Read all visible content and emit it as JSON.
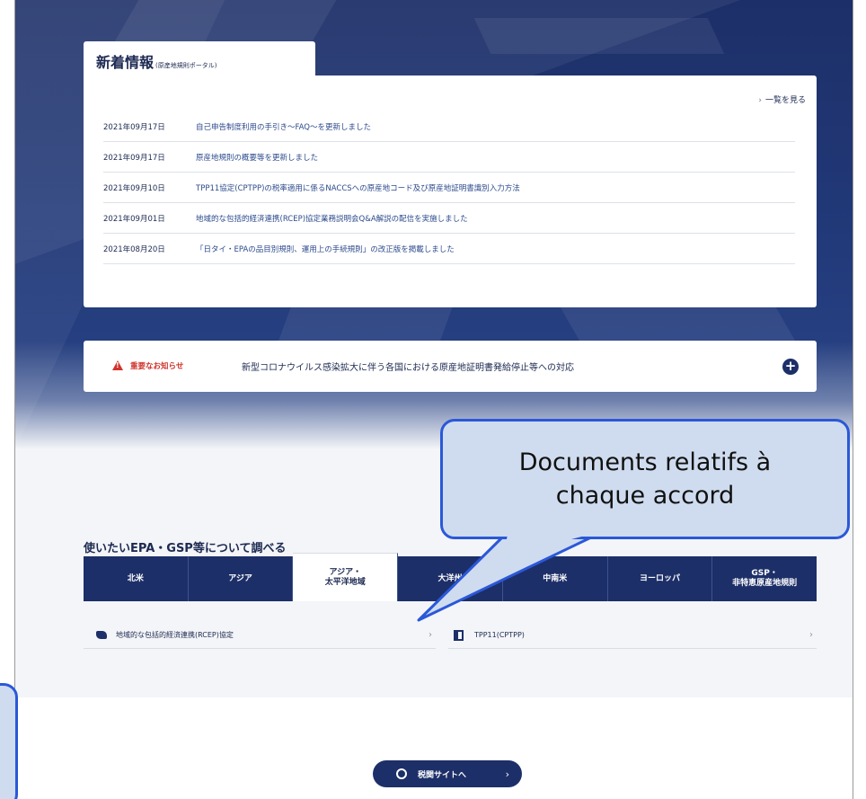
{
  "news": {
    "title": "新着情報",
    "subtitle": "(原産地規則ポータル)",
    "see_all": "一覧を見る",
    "items": [
      {
        "date": "2021年09月17日",
        "text": "自己申告制度利用の手引き～FAQ～を更新しました"
      },
      {
        "date": "2021年09月17日",
        "text": "原産地規則の概要等を更新しました"
      },
      {
        "date": "2021年09月10日",
        "text": "TPP11協定(CPTPP)の税率適用に係るNACCSへの原産地コード及び原産地証明書識別入力方法"
      },
      {
        "date": "2021年09月01日",
        "text": "地域的な包括的経済連携(RCEP)協定業務説明会Q&A解説の配信を実施しました"
      },
      {
        "date": "2021年08月20日",
        "text": "「日タイ・EPAの品目別規則、運用上の手続規則」の改正版を掲載しました"
      }
    ]
  },
  "notice": {
    "label": "重要なお知らせ",
    "message": "新型コロナウイルス感染拡大に伴う各国における原産地証明書発給停止等への対応"
  },
  "section": {
    "title": "使いたいEPA・GSP等について調べる"
  },
  "tabs": [
    {
      "label": "北米"
    },
    {
      "label": "アジア"
    },
    {
      "label": "アジア・\n太平洋地域"
    },
    {
      "label": "大洋州"
    },
    {
      "label": "中南米"
    },
    {
      "label": "ヨーロッパ"
    },
    {
      "label": "GSP・\n非特恵原産地規則"
    }
  ],
  "active_tab": 2,
  "documents": [
    {
      "label": "地域的な包括的経済連携(RCEP)協定"
    },
    {
      "label": "TPP11(CPTPP)"
    }
  ],
  "customs_button": {
    "label": "税関サイトへ"
  },
  "callout": {
    "line1": "Documents relatifs à",
    "line2": "chaque accord"
  },
  "colors": {
    "navy": "#1d2f68",
    "alert_red": "#d0342c",
    "callout_fill": "#cfdcef",
    "callout_border": "#2b58d8"
  }
}
